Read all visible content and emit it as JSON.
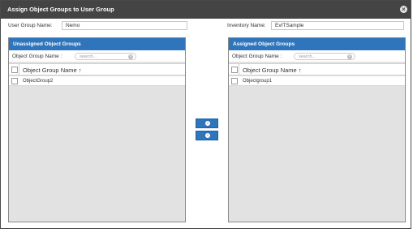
{
  "dialog": {
    "title": "Assign Object Groups to User Group",
    "close_icon": "close-circle-icon",
    "user_group_label": "User Group Name:",
    "user_group_value": "Nemo",
    "inventory_label": "Inventory Name:",
    "inventory_value": "EvITSample"
  },
  "unassigned": {
    "header": "Unassigned Object Groups",
    "filter_label": "Object Group Name :",
    "search_placeholder": "search...",
    "column_header": "Object Group Name",
    "sort_icon": "sort-ascending-icon",
    "rows": [
      "ObjectGroup2"
    ]
  },
  "assigned": {
    "header": "Assigned Object Groups",
    "filter_label": "Object Group Name :",
    "search_placeholder": "search...",
    "column_header": "Object Group Name",
    "sort_icon": "sort-ascending-icon",
    "rows": [
      "Objectgroup1"
    ]
  },
  "actions": {
    "assign_icon": "arrow-right-icon",
    "unassign_icon": "arrow-left-icon"
  },
  "colors": {
    "titlebar": "#444444",
    "accent": "#2f75bb",
    "panel_bg": "#e2e2e2"
  }
}
